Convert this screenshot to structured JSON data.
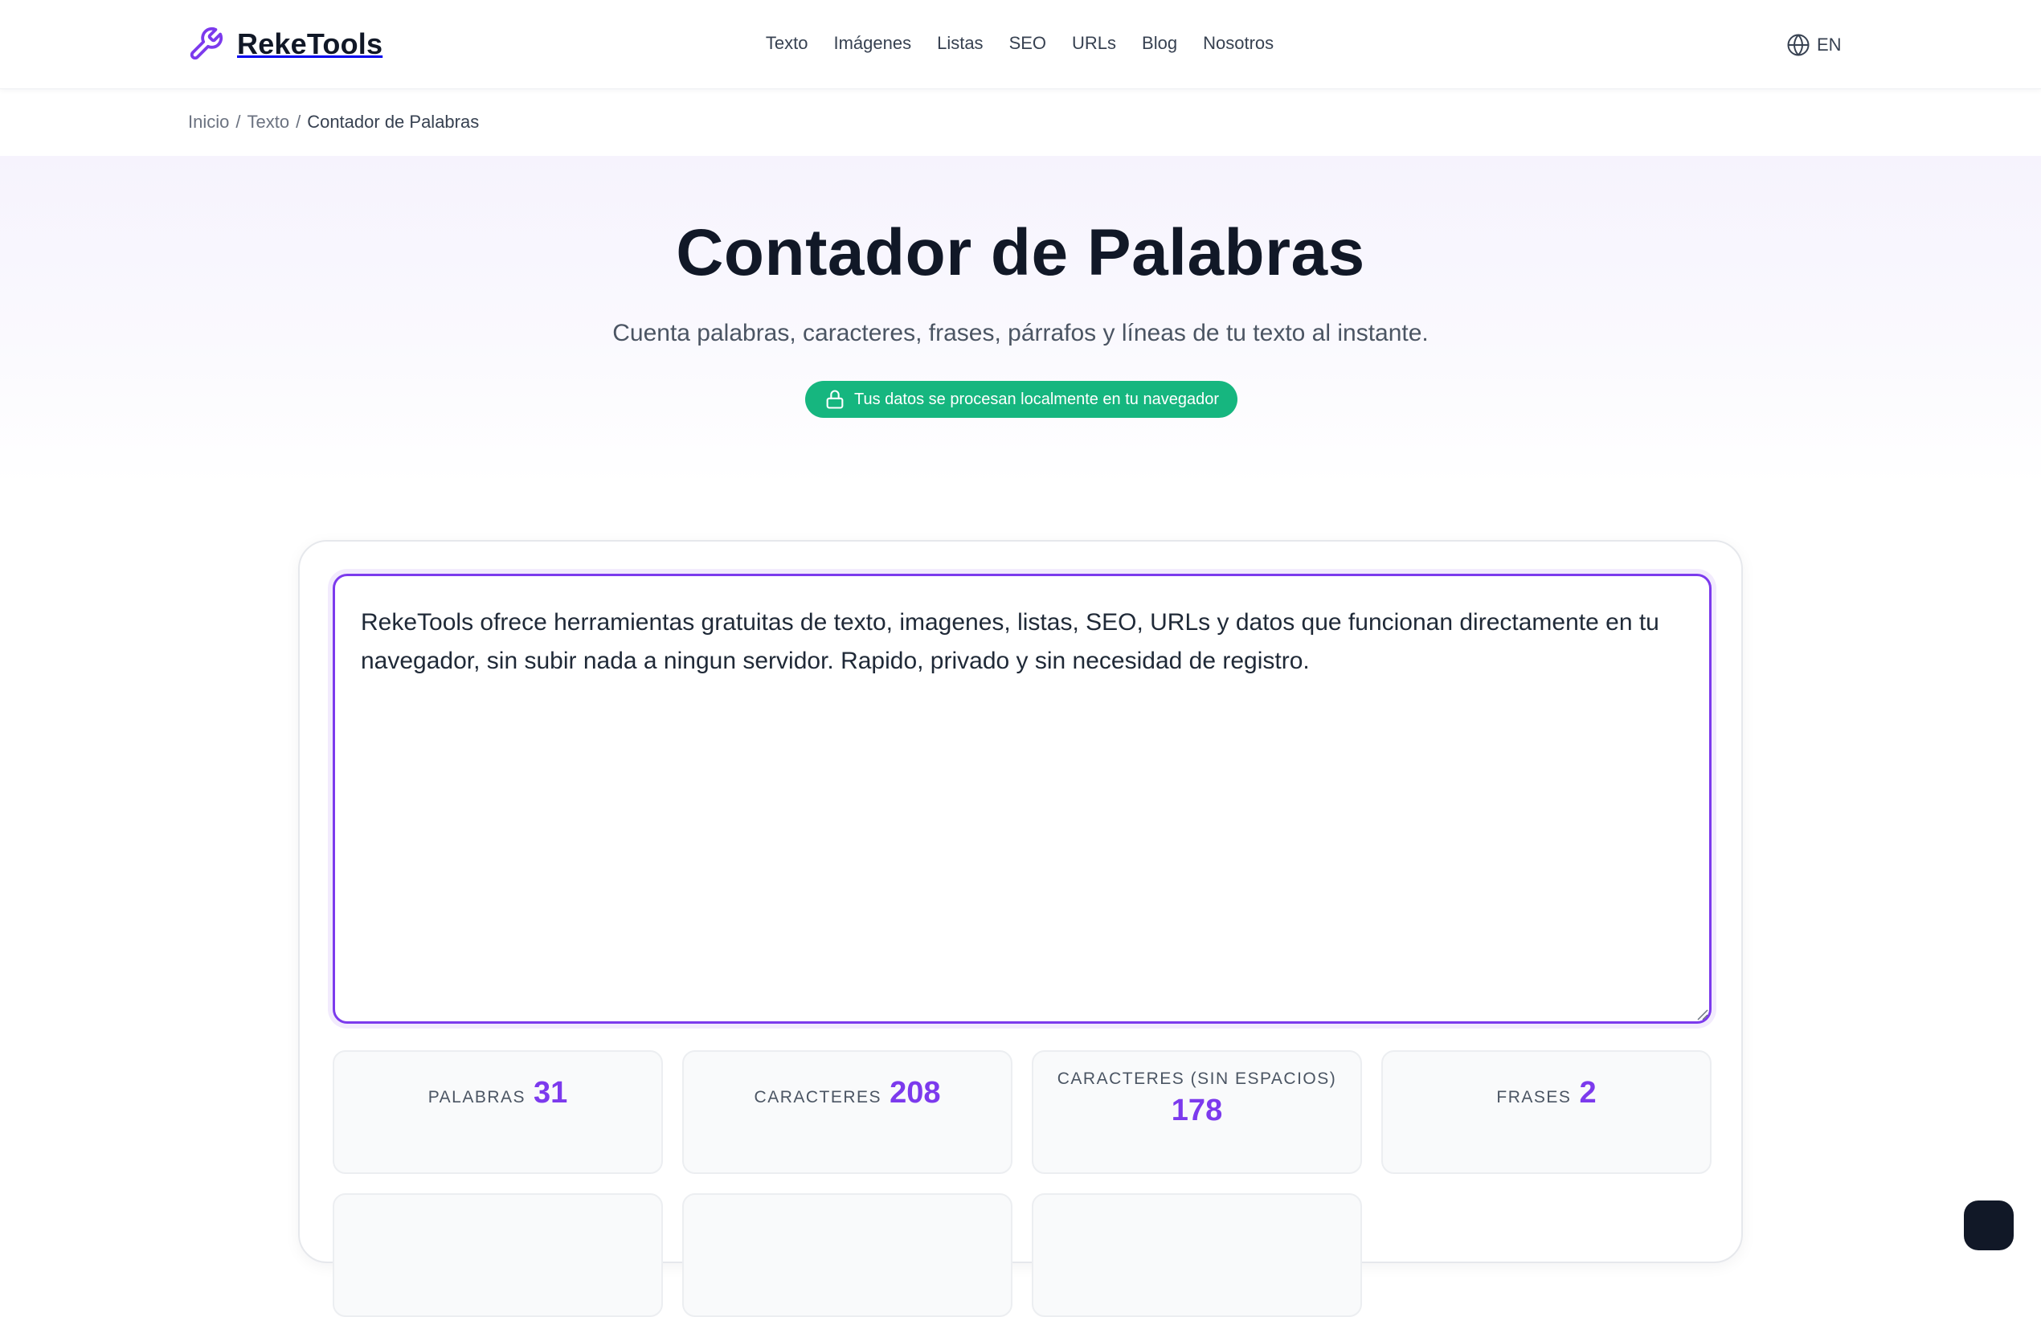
{
  "brand": {
    "name": "RekeTools",
    "logo_icon": "wrench-icon",
    "accent_color": "#7c3aed"
  },
  "nav": {
    "items": [
      {
        "label": "Texto"
      },
      {
        "label": "Imágenes"
      },
      {
        "label": "Listas"
      },
      {
        "label": "SEO"
      },
      {
        "label": "URLs"
      },
      {
        "label": "Blog"
      },
      {
        "label": "Nosotros"
      }
    ],
    "language": {
      "label": "EN",
      "icon": "globe-icon"
    }
  },
  "breadcrumb": {
    "items": [
      "Inicio",
      "Texto"
    ],
    "separator": "/",
    "current": "Contador de Palabras"
  },
  "hero": {
    "title": "Contador de Palabras",
    "subtitle": "Cuenta palabras, caracteres, frases, párrafos y líneas de tu texto al instante.",
    "privacy_badge": "Tus datos se procesan localmente en tu navegador",
    "privacy_icon": "lock-icon",
    "badge_color": "#16b67f"
  },
  "tool": {
    "input_text": "RekeTools ofrece herramientas gratuitas de texto, imagenes, listas, SEO, URLs y datos que funcionan directamente en tu navegador, sin subir nada a ningun servidor. Rapido, privado y sin necesidad de registro.",
    "stats": [
      {
        "label": "PALABRAS",
        "value": "31"
      },
      {
        "label": "CARACTERES",
        "value": "208"
      },
      {
        "label": "CARACTERES (SIN ESPACIOS)",
        "value": "178"
      },
      {
        "label": "FRASES",
        "value": "2"
      }
    ]
  }
}
